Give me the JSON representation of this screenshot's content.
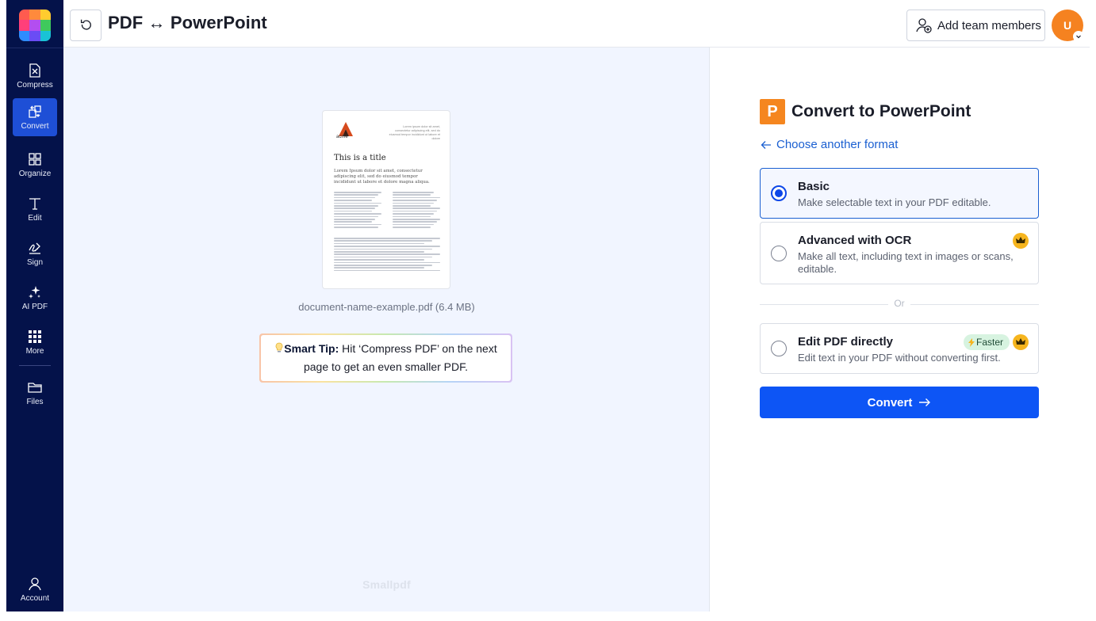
{
  "app": {
    "title": "PDF ↔ PowerPoint",
    "watermark": "Smallpdf"
  },
  "sidebar": {
    "items": [
      {
        "label": "Compress",
        "icon": "compress-icon"
      },
      {
        "label": "Convert",
        "icon": "convert-icon",
        "active": true
      },
      {
        "label": "Organize",
        "icon": "grid-icon"
      },
      {
        "label": "Edit",
        "icon": "text-icon"
      },
      {
        "label": "Sign",
        "icon": "signature-icon"
      },
      {
        "label": "AI PDF",
        "icon": "sparkle-icon"
      },
      {
        "label": "More",
        "icon": "apps-icon"
      },
      {
        "label": "Files",
        "icon": "folder-icon"
      },
      {
        "label": "Account",
        "icon": "user-icon"
      }
    ]
  },
  "header": {
    "add_team_label": "Add team members",
    "avatar_initial": "U"
  },
  "preview": {
    "file_name": "document-name-example.pdf (6.4 MB)",
    "doc_title": "This is a title",
    "doc_brand": "acme",
    "doc_lead": "Lorem Ipsum dolor sit amet, consectetur adipiscing elit, sed do eiusmod tempor incididunt ut labore et dolore magna aliqua.",
    "doc_header_text": "Lorem ipsum dolor sit amet, consectetur adipiscing elit, sed do eiusmod tempor incididunt ut labore et dolore",
    "tip_label": "Smart Tip:",
    "tip_text": " Hit ‘Compress PDF’ on the next page to get an even smaller PDF."
  },
  "convert_panel": {
    "title": "Convert to PowerPoint",
    "icon_letter": "P",
    "choose_link": "Choose another format",
    "or_label": "Or",
    "options": [
      {
        "title": "Basic",
        "desc": "Make selectable text in your PDF editable.",
        "selected": true
      },
      {
        "title": "Advanced with OCR",
        "desc": "Make all text, including text in images or scans, editable.",
        "premium": true
      },
      {
        "title": "Edit PDF directly",
        "desc": "Edit text in your PDF without converting first.",
        "badge": "Faster",
        "premium": true
      }
    ],
    "convert_label": "Convert"
  },
  "colors": {
    "sidebar_bg": "#04124a",
    "active_nav": "#1e4fd6",
    "primary": "#0d55f5",
    "link": "#1a5fd1",
    "ppt_orange": "#f5861f",
    "avatar": "#f58220",
    "preview_bg": "#f1f5ff"
  }
}
